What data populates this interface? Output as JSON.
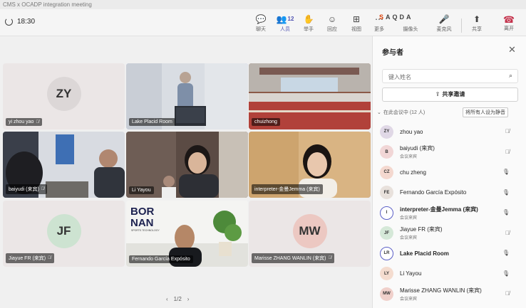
{
  "window": {
    "title": "CMS x OCADP integration meeting"
  },
  "toolbar": {
    "timer": "18:30",
    "buttons": [
      {
        "id": "chat",
        "glyph": "💬",
        "label": "聊天"
      },
      {
        "id": "people",
        "glyph": "👥",
        "count": "12",
        "label": "人员"
      },
      {
        "id": "raise",
        "glyph": "✋",
        "label": "举手"
      },
      {
        "id": "react",
        "glyph": "☺",
        "label": "回应"
      },
      {
        "id": "view",
        "glyph": "⊞",
        "label": "视图"
      },
      {
        "id": "more",
        "glyph": "⋯",
        "label": "更多"
      },
      {
        "id": "camera",
        "glyph": "📷",
        "label": "摄像头"
      },
      {
        "id": "mic",
        "glyph": "🎤",
        "label": "麦克风"
      },
      {
        "id": "share",
        "glyph": "⬆",
        "label": "共享"
      }
    ],
    "cluster": [
      "S",
      "A",
      "Q",
      "D",
      "A"
    ],
    "leave": {
      "glyph": "☎",
      "label": "离开"
    }
  },
  "stage": {
    "tiles": [
      {
        "name": "yi zhou yao",
        "initials": "ZY",
        "avatar_bg": "#dcd7d7",
        "muted": true,
        "video": false
      },
      {
        "name": "Lake Placid Room",
        "video": true,
        "speaking": true,
        "scene": "presenter"
      },
      {
        "name": "chuizhong",
        "video": true,
        "scene": "conference-hall"
      },
      {
        "name": "baiyudi (来宾)",
        "video": true,
        "muted": true,
        "scene": "office-two"
      },
      {
        "name": "Li Yayou",
        "video": true,
        "scene": "office-woman"
      },
      {
        "name": "interpreter-金曼Jemma (来宾)",
        "video": true,
        "speaking": true,
        "scene": "interpreter"
      },
      {
        "name": "Jiayue FR (来宾)",
        "initials": "JF",
        "avatar_bg": "#cde3d1",
        "muted": true,
        "video": false
      },
      {
        "name": "Fernando García Expósito",
        "video": true,
        "scene": "bornan",
        "logo": "BOR NAN",
        "logo_sub": "SPORTS TECHNOLOGY"
      },
      {
        "name": "Marisse ZHANG WANLIN (来宾)",
        "initials": "MW",
        "avatar_bg": "#ecc8c2",
        "muted": true,
        "video": false
      }
    ],
    "pager": {
      "prev": "‹",
      "label": "1/2",
      "next": "›"
    }
  },
  "panel": {
    "title": "参与者",
    "search_placeholder": "键入姓名",
    "share_label": "共享邀请",
    "section_label": "在此会议中 (12 人)",
    "mute_all_label": "将所有人设为静音",
    "participants": [
      {
        "initials": "ZY",
        "name": "zhou yao",
        "sub": "",
        "avatar_bg": "#e0d8e6",
        "mic": "muted"
      },
      {
        "initials": "B",
        "name": "baiyudi (来宾)",
        "sub": "会议来宾",
        "avatar_bg": "#f1d6d6",
        "mic": "muted"
      },
      {
        "initials": "CZ",
        "name": "chu zheng",
        "sub": "",
        "avatar_bg": "#f4d8cf",
        "mic": "on"
      },
      {
        "initials": "FE",
        "name": "Fernando García Expósito",
        "sub": "",
        "avatar_bg": "#e8e1dc",
        "mic": "on"
      },
      {
        "initials": "I",
        "name": "interpreter-金曼Jemma (来宾)",
        "sub": "会议来宾",
        "avatar_bg": "#f5e9c9",
        "mic": "on",
        "ring": true
      },
      {
        "initials": "JF",
        "name": "Jiayue FR (来宾)",
        "sub": "会议来宾",
        "avatar_bg": "#d5e8d8",
        "mic": "muted"
      },
      {
        "initials": "LR",
        "name": "Lake Placid Room",
        "sub": "",
        "avatar_bg": "#e0e1f3",
        "mic": "on",
        "ring": true
      },
      {
        "initials": "LY",
        "name": "Li Yayou",
        "sub": "",
        "avatar_bg": "#f4dccf",
        "mic": "on"
      },
      {
        "initials": "MW",
        "name": "Marisse ZHANG WANLIN (来宾)",
        "sub": "会议来宾",
        "avatar_bg": "#f0d0cb",
        "mic": "muted"
      }
    ]
  }
}
